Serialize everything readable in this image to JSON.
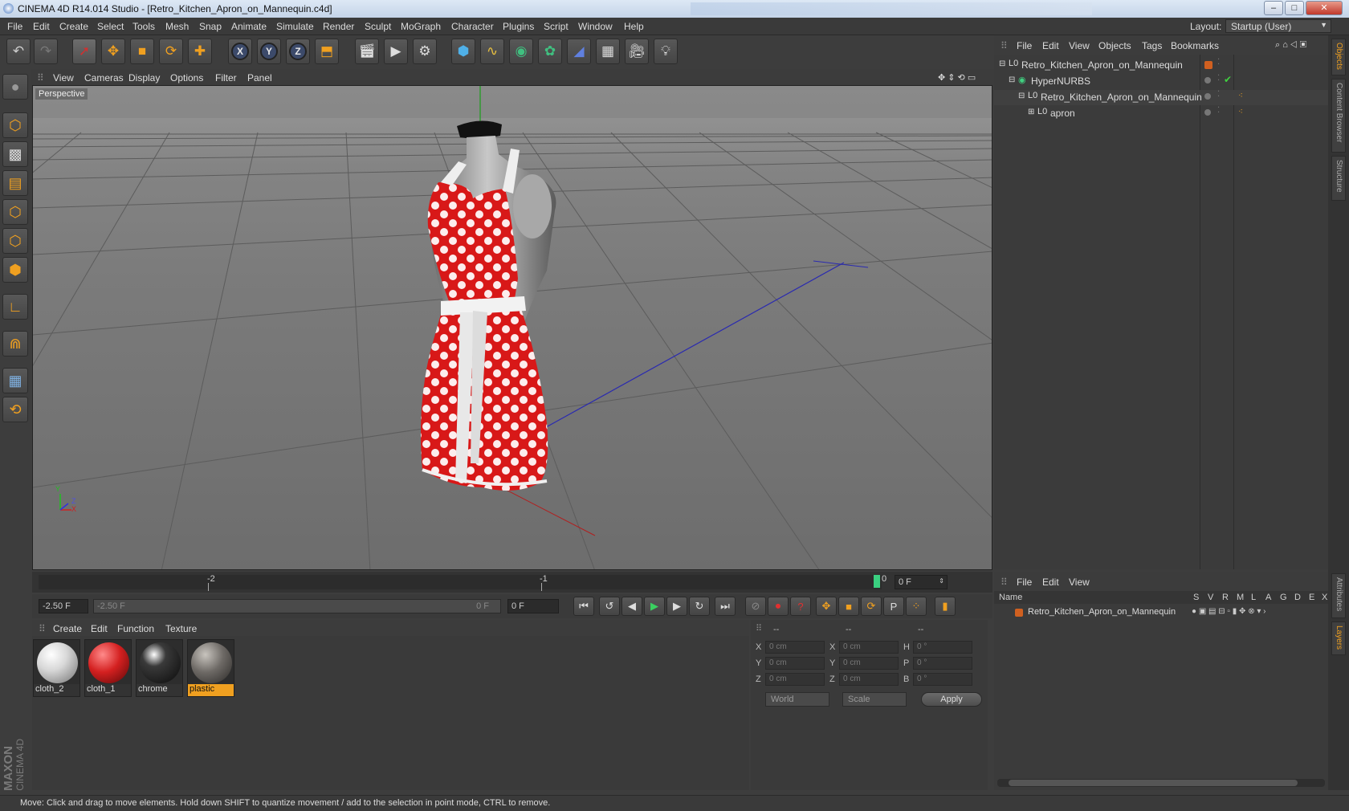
{
  "window": {
    "title": "CINEMA 4D R14.014 Studio - [Retro_Kitchen_Apron_on_Mannequin.c4d]"
  },
  "menu": [
    "File",
    "Edit",
    "Create",
    "Select",
    "Tools",
    "Mesh",
    "Snap",
    "Animate",
    "Simulate",
    "Render",
    "Sculpt",
    "MoGraph",
    "Character",
    "Plugins",
    "Script",
    "Window",
    "Help"
  ],
  "layout": {
    "label": "Layout:",
    "value": "Startup (User)"
  },
  "viewport": {
    "menu": [
      "View",
      "Cameras",
      "Display",
      "Options",
      "Filter",
      "Panel"
    ],
    "label": "Perspective",
    "axis": {
      "y": "Y",
      "z": "Z",
      "x": "X"
    }
  },
  "timeline": {
    "ticks": [
      "-2",
      "-1",
      "0"
    ],
    "frame_field": "0 F"
  },
  "transport": {
    "start": "-2.50 F",
    "range_start": "-2.50 F",
    "range_end": "0 F",
    "end": "0 F"
  },
  "materials": {
    "menu": [
      "Create",
      "Edit",
      "Function",
      "Texture"
    ],
    "items": [
      {
        "name": "cloth_2",
        "color": "#e0e0e0"
      },
      {
        "name": "cloth_1",
        "color": "#d42020"
      },
      {
        "name": "chrome",
        "color": "#1a1a1a"
      },
      {
        "name": "plastic",
        "color": "#6e6a66"
      }
    ]
  },
  "coords": {
    "header": [
      "--",
      "--",
      "--"
    ],
    "rows": [
      {
        "a": "X",
        "av": "0 cm",
        "b": "X",
        "bv": "0 cm",
        "c": "H",
        "cv": "0 °"
      },
      {
        "a": "Y",
        "av": "0 cm",
        "b": "Y",
        "bv": "0 cm",
        "c": "P",
        "cv": "0 °"
      },
      {
        "a": "Z",
        "av": "0 cm",
        "b": "Z",
        "bv": "0 cm",
        "c": "B",
        "cv": "0 °"
      }
    ],
    "space": "World",
    "mode": "Scale",
    "apply": "Apply"
  },
  "objects": {
    "menu": [
      "File",
      "Edit",
      "View",
      "Objects",
      "Tags",
      "Bookmarks"
    ],
    "tree": [
      {
        "name": "Retro_Kitchen_Apron_on_Mannequin",
        "indent": 0
      },
      {
        "name": "HyperNURBS",
        "indent": 1
      },
      {
        "name": "Retro_Kitchen_Apron_on_Mannequin",
        "indent": 2
      },
      {
        "name": "apron",
        "indent": 3
      }
    ]
  },
  "layers": {
    "menu": [
      "File",
      "Edit",
      "View"
    ],
    "columns": [
      "Name",
      "S",
      "V",
      "R",
      "M",
      "L",
      "A",
      "G",
      "D",
      "E",
      "X"
    ],
    "rows": [
      {
        "name": "Retro_Kitchen_Apron_on_Mannequin",
        "color": "#d06020"
      }
    ]
  },
  "side_tabs": [
    "Objects",
    "Content Browser",
    "Structure",
    "Attributes",
    "Layers"
  ],
  "status": "Move: Click and drag to move elements. Hold down SHIFT to quantize movement / add to the selection in point mode, CTRL to remove.",
  "brand": {
    "line1": "MAXON",
    "line2": "CINEMA 4D"
  },
  "accent": "#f0a020"
}
